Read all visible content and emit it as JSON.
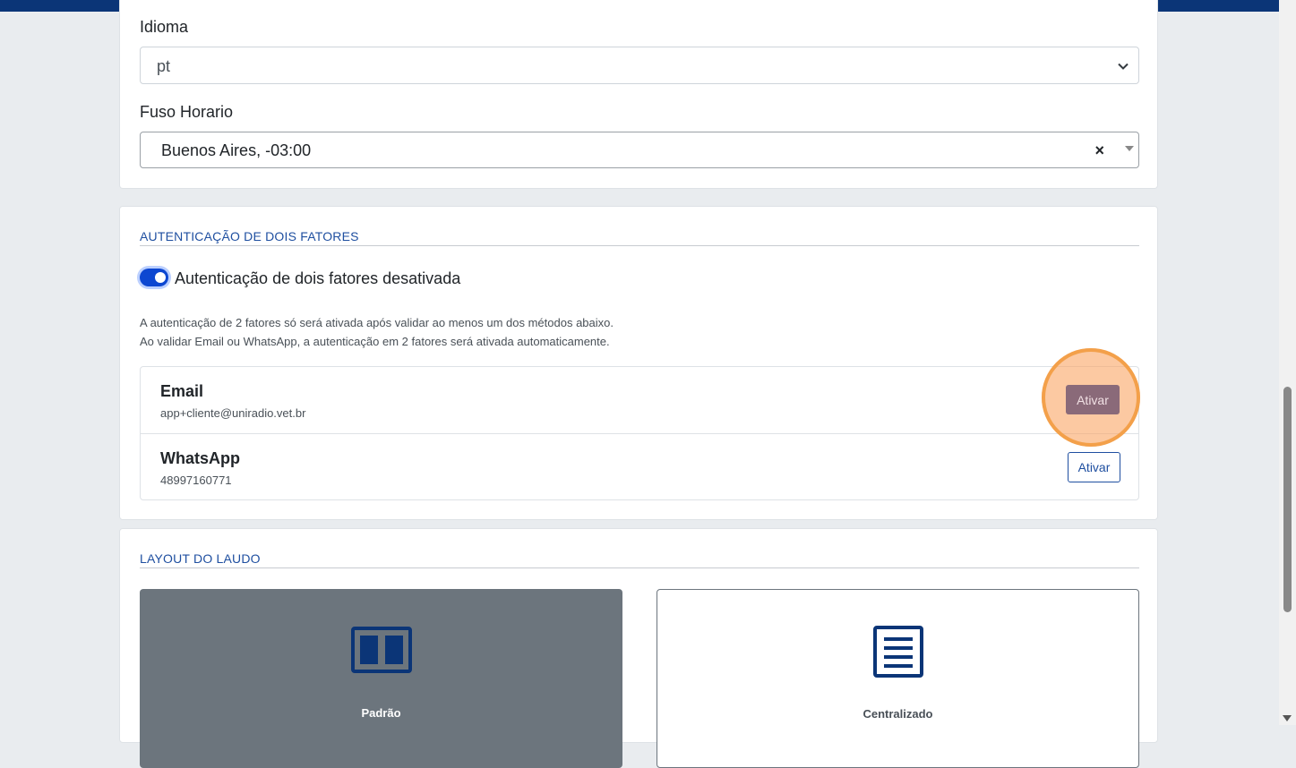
{
  "settings": {
    "language_label": "Idioma",
    "language_value": "pt",
    "timezone_label": "Fuso Horario",
    "timezone_value": "Buenos Aires, -03:00",
    "clear_symbol": "×"
  },
  "two_factor": {
    "section_title": "AUTENTICAÇÃO DE DOIS FATORES",
    "toggle_label": "Autenticação de dois fatores desativada",
    "toggle_on": true,
    "help_line1": "A autenticação de 2 fatores só será ativada após validar ao menos um dos métodos abaixo.",
    "help_line2": "Ao validar Email ou WhatsApp, a autenticação em 2 fatores será ativada automaticamente.",
    "methods": [
      {
        "title": "Email",
        "value": "app+cliente@uniradio.vet.br",
        "button": "Ativar"
      },
      {
        "title": "WhatsApp",
        "value": "48997160771",
        "button": "Ativar"
      }
    ]
  },
  "layout": {
    "section_title": "LAYOUT DO LAUDO",
    "options": [
      {
        "label": "Padrão",
        "icon": "columns-icon",
        "selected": true
      },
      {
        "label": "Centralizado",
        "icon": "document-lines-icon",
        "selected": false
      }
    ]
  },
  "colors": {
    "topbar": "#0b3577",
    "accent": "#1f4fa0",
    "highlight": "#f3a04a"
  }
}
